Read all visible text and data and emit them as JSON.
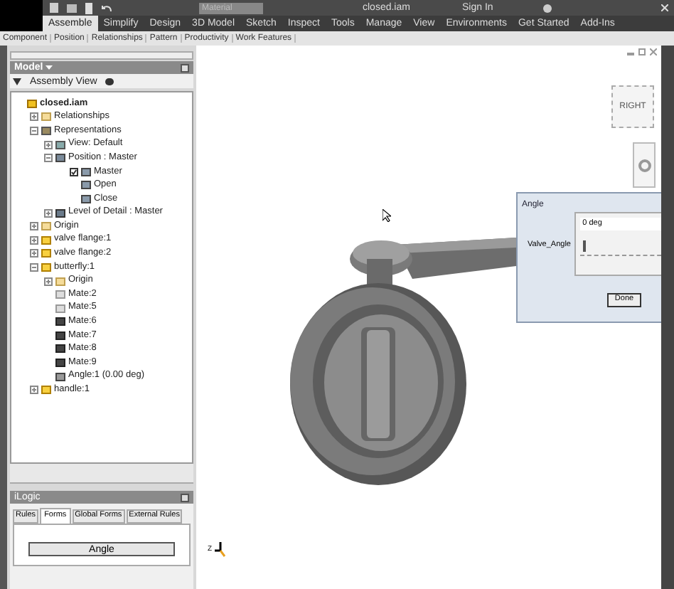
{
  "title_bar": {
    "material": "Material",
    "title": "closed.iam",
    "sign_in": "Sign In"
  },
  "ribbon_tabs": [
    {
      "label": "Assemble",
      "selected": true
    },
    {
      "label": "Simplify",
      "selected": false
    },
    {
      "label": "Design",
      "selected": false
    },
    {
      "label": "3D Model",
      "selected": false
    },
    {
      "label": "Sketch",
      "selected": false
    },
    {
      "label": "Inspect",
      "selected": false
    },
    {
      "label": "Tools",
      "selected": false
    },
    {
      "label": "Manage",
      "selected": false
    },
    {
      "label": "View",
      "selected": false
    },
    {
      "label": "Environments",
      "selected": false
    },
    {
      "label": "Get Started",
      "selected": false
    },
    {
      "label": "Add-Ins",
      "selected": false
    }
  ],
  "panel_tabs": [
    "Component",
    "Position",
    "Relationships",
    "Pattern",
    "Productivity",
    "Work Features"
  ],
  "model_panel": {
    "title": "Model",
    "view": "Assembly View",
    "tree": [
      {
        "label": "closed.iam",
        "kind": "assembly",
        "children": [
          {
            "label": "Relationships",
            "kind": "folder",
            "expanded": false
          },
          {
            "label": "Representations",
            "kind": "representations",
            "expanded": true,
            "children": [
              {
                "label": "View: Default",
                "kind": "view",
                "expanded": false
              },
              {
                "label": "Position : Master",
                "kind": "position",
                "expanded": true,
                "children": [
                  {
                    "label": "Master",
                    "kind": "position_item",
                    "checked": true
                  },
                  {
                    "label": "Open",
                    "kind": "position_item",
                    "checked": false
                  },
                  {
                    "label": "Close",
                    "kind": "position_item",
                    "checked": false
                  }
                ]
              },
              {
                "label": "Level of Detail : Master",
                "kind": "lod",
                "expanded": false
              }
            ]
          },
          {
            "label": "Origin",
            "kind": "folder",
            "expanded": false
          },
          {
            "label": "valve flange:1",
            "kind": "part",
            "expanded": false
          },
          {
            "label": "valve flange:2",
            "kind": "part",
            "expanded": false
          },
          {
            "label": "butterfly:1",
            "kind": "part",
            "expanded": true,
            "children": [
              {
                "label": "Origin",
                "kind": "folder",
                "expanded": false
              },
              {
                "label": "Mate:2",
                "kind": "mate_flush"
              },
              {
                "label": "Mate:5",
                "kind": "mate_flush"
              },
              {
                "label": "Mate:6",
                "kind": "mate"
              },
              {
                "label": "Mate:7",
                "kind": "mate"
              },
              {
                "label": "Mate:8",
                "kind": "mate"
              },
              {
                "label": "Mate:9",
                "kind": "mate"
              },
              {
                "label": "Angle:1 (0.00 deg)",
                "kind": "angle"
              }
            ]
          },
          {
            "label": "handle:1",
            "kind": "part",
            "expanded": false
          }
        ]
      }
    ]
  },
  "ilogic_panel": {
    "title": "iLogic",
    "tabs": [
      {
        "label": "Rules",
        "selected": false
      },
      {
        "label": "Forms",
        "selected": true
      },
      {
        "label": "Global Forms",
        "selected": false
      },
      {
        "label": "External Rules",
        "selected": false
      }
    ],
    "form_button": "Angle"
  },
  "viewcube": {
    "face": "RIGHT"
  },
  "triad": {
    "axis": "Z"
  },
  "angle_dialog": {
    "title": "Angle",
    "label": "Valve_Angle",
    "value": "0 deg",
    "slider": {
      "level": 0
    },
    "button": "Done"
  }
}
